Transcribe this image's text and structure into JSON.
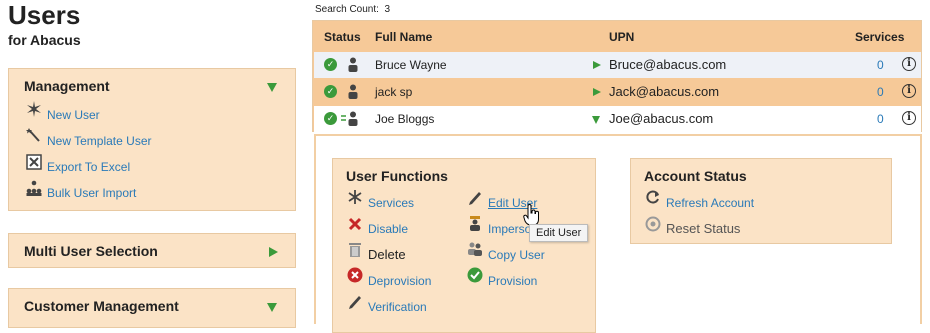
{
  "page": {
    "title": "Users",
    "subtitle": "for Abacus"
  },
  "management": {
    "title": "Management",
    "items": [
      {
        "label": "New User",
        "icon": "sparkle-icon"
      },
      {
        "label": "New Template User",
        "icon": "wand-icon"
      },
      {
        "label": "Export To Excel",
        "icon": "excel-icon"
      },
      {
        "label": "Bulk User Import",
        "icon": "org-chart-icon"
      }
    ]
  },
  "multi_user": {
    "title": "Multi User Selection"
  },
  "customer_mgmt": {
    "title": "Customer Management"
  },
  "search": {
    "label": "Search Count:",
    "count": "3"
  },
  "table": {
    "headers": [
      "Status",
      "Full Name",
      "UPN",
      "Services"
    ],
    "rows": [
      {
        "name": "Bruce Wayne",
        "upn": "Bruce@abacus.com",
        "services": "0"
      },
      {
        "name": "jack sp",
        "upn": "Jack@abacus.com",
        "services": "0"
      },
      {
        "name": "Joe Bloggs",
        "upn": "Joe@abacus.com",
        "services": "0"
      }
    ]
  },
  "user_functions": {
    "title": "User Functions",
    "items": [
      {
        "label": "Services",
        "icon": "snowflake-icon"
      },
      {
        "label": "Edit User",
        "icon": "pencil-icon"
      },
      {
        "label": "Disable",
        "icon": "x-icon"
      },
      {
        "label": "Imperso",
        "icon": "impersonate-icon"
      },
      {
        "label": "Delete",
        "icon": "trash-icon"
      },
      {
        "label": "Copy User",
        "icon": "users-icon"
      },
      {
        "label": "Deprovision",
        "icon": "circle-x-icon"
      },
      {
        "label": "Provision",
        "icon": "check-circle-icon"
      },
      {
        "label": "Verification",
        "icon": "pencil-icon"
      }
    ]
  },
  "account_status": {
    "title": "Account Status",
    "items": [
      {
        "label": "Refresh Account",
        "icon": "refresh-icon"
      },
      {
        "label": "Reset Status",
        "icon": "reset-icon"
      }
    ]
  },
  "tooltip": {
    "text": "Edit User"
  },
  "colors": {
    "accent_green": "#3b9a3b",
    "panel_bg": "#fbe3c6",
    "header_bg": "#f6c998",
    "link": "#2a7ab8"
  }
}
